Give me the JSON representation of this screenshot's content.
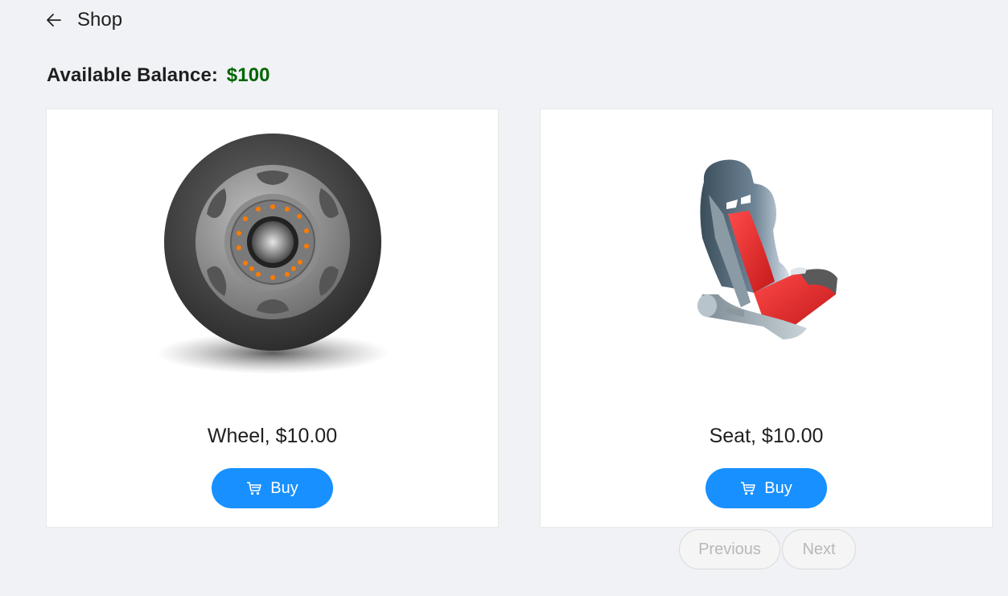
{
  "header": {
    "title": "Shop",
    "back_icon": "arrow-left-icon"
  },
  "balance": {
    "label": "Available Balance:",
    "amount": "$100",
    "amount_color": "#006400"
  },
  "products": [
    {
      "name_price": "Wheel, $10.00",
      "buy_label": "Buy",
      "image": "wheel"
    },
    {
      "name_price": "Seat, $10.00",
      "buy_label": "Buy",
      "image": "racing-seat"
    }
  ],
  "pagination": {
    "previous": "Previous",
    "next": "Next"
  },
  "colors": {
    "primary": "#1890ff",
    "background": "#f0f2f5"
  }
}
